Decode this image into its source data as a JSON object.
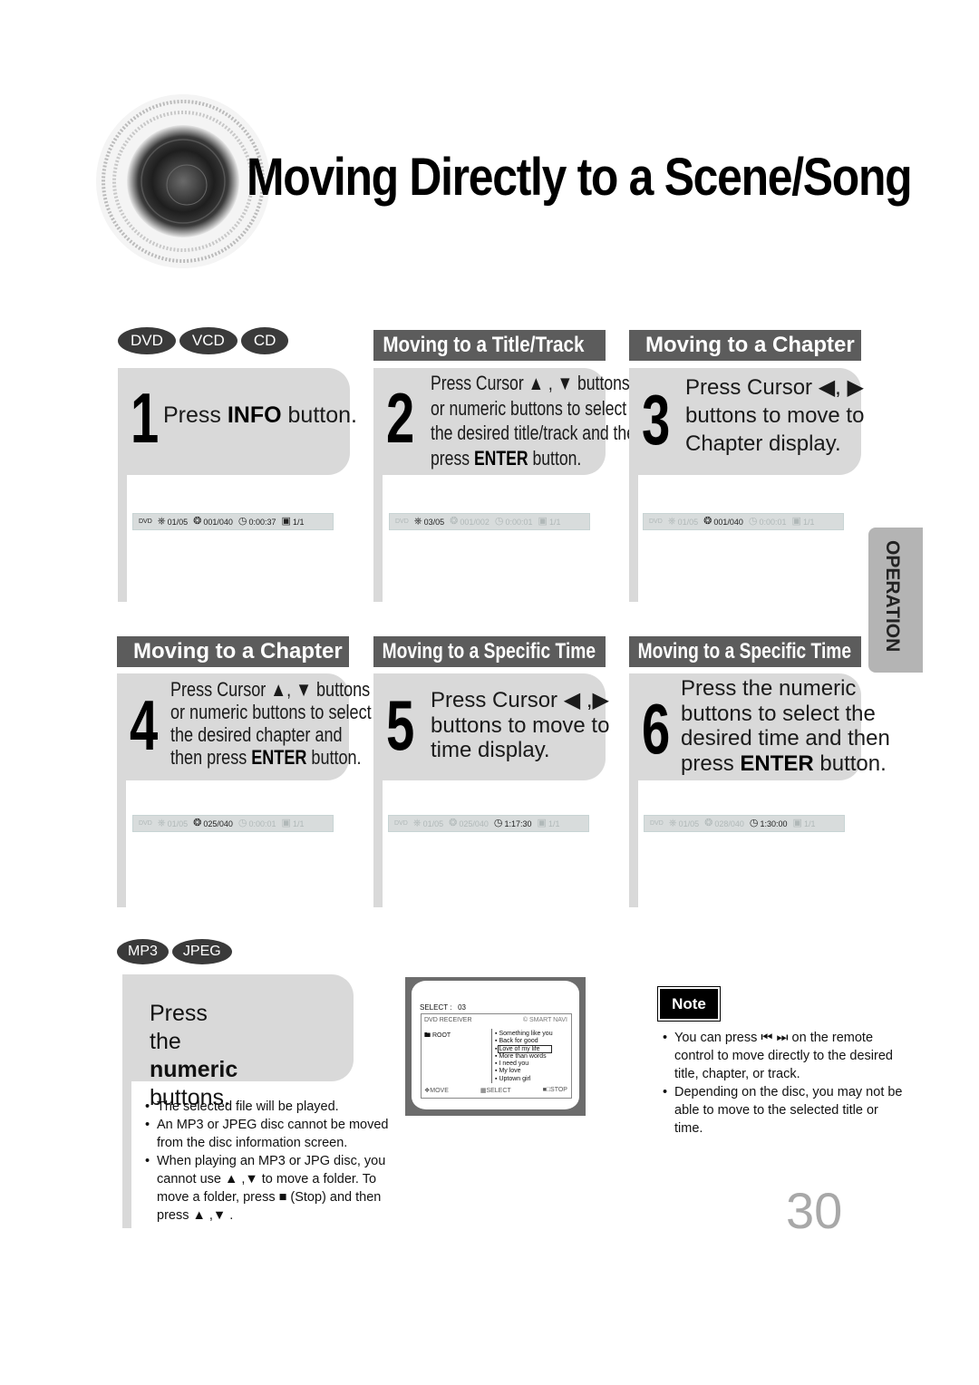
{
  "page": {
    "title": "Moving Directly to a Scene/Song",
    "page_number": "30",
    "side_tab": "OPERATION"
  },
  "disc_badges": [
    "DVD",
    "VCD",
    "CD"
  ],
  "file_badges": [
    "MP3",
    "JPEG"
  ],
  "sections": {
    "title_track": "Moving to a Title/Track",
    "chapter_top": "Moving to a Chapter",
    "chapter_bottom": "Moving to a Chapter",
    "time_5": "Moving to a Specific Time",
    "time_6": "Moving to a Specific Time"
  },
  "steps": [
    {
      "number": "1",
      "lines": [
        [
          "Press ",
          "INFO",
          " button."
        ]
      ],
      "infobar": {
        "disc": "DVD",
        "title": "01/05",
        "chapter": "001/040",
        "time": "0:00:37",
        "angle": "1/1",
        "highlight": "all"
      }
    },
    {
      "number": "2",
      "lines": [
        [
          "Press Cursor ",
          "",
          " ▲ , ▼ buttons"
        ],
        [
          "or numeric buttons to select",
          "",
          ""
        ],
        [
          "the desired title/track and then",
          "",
          ""
        ],
        [
          "press ",
          "ENTER",
          " button."
        ]
      ],
      "infobar": {
        "disc": "DVD",
        "title": "03/05",
        "chapter": "001/002",
        "time": "0:00:01",
        "angle": "1/1",
        "highlight": "title"
      }
    },
    {
      "number": "3",
      "lines": [
        [
          "Press Cursor ◀, ▶",
          "",
          ""
        ],
        [
          "buttons to move to",
          "",
          ""
        ],
        [
          "Chapter display.",
          "",
          ""
        ]
      ],
      "infobar": {
        "disc": "DVD",
        "title": "01/05",
        "chapter": "001/040",
        "time": "0:00:01",
        "angle": "1/1",
        "highlight": "chapter"
      }
    },
    {
      "number": "4",
      "lines": [
        [
          "Press Cursor ▲, ▼ buttons",
          "",
          ""
        ],
        [
          "or numeric buttons to select",
          "",
          ""
        ],
        [
          "the desired chapter and",
          "",
          ""
        ],
        [
          "then press ",
          "ENTER",
          " button."
        ]
      ],
      "infobar": {
        "disc": "DVD",
        "title": "01/05",
        "chapter": "025/040",
        "time": "0:00:01",
        "angle": "1/1",
        "highlight": "chapter"
      }
    },
    {
      "number": "5",
      "lines": [
        [
          "Press Cursor ◀ ,▶",
          "",
          ""
        ],
        [
          "buttons to move to",
          "",
          ""
        ],
        [
          "time display.",
          "",
          ""
        ]
      ],
      "infobar": {
        "disc": "DVD",
        "title": "01/05",
        "chapter": "025/040",
        "time": "1:17:30",
        "angle": "1/1",
        "highlight": "time"
      }
    },
    {
      "number": "6",
      "lines": [
        [
          "Press the numeric",
          "",
          ""
        ],
        [
          "buttons to select the",
          "",
          ""
        ],
        [
          "desired time and then",
          "",
          ""
        ],
        [
          "press ",
          "ENTER",
          " button."
        ]
      ],
      "infobar": {
        "disc": "DVD",
        "title": "01/05",
        "chapter": "028/040",
        "time": "1:30:00",
        "angle": "1/1",
        "highlight": "time"
      }
    }
  ],
  "mp3": {
    "instruction_pre": "Press the ",
    "instruction_bold": "numeric",
    "instruction_post": "buttons.",
    "bullets": [
      "The selected file will be played.",
      "An MP3 or JPEG disc cannot be moved from the disc information screen.",
      "When playing an MP3 or JPG disc, you cannot use ▲ ,▼  to move a folder. To move a folder, press ■ (Stop) and then press ▲ ,▼ ."
    ]
  },
  "screen": {
    "select_label": "SELECT :",
    "select_value": "03",
    "header_left": "DVD RECEIVER",
    "header_right": "© SMART NAVI",
    "root": "ROOT",
    "files": [
      "Something like you",
      "Back for good",
      "Love of my life",
      "More than words",
      "I need you",
      "My love",
      "Uptown girl"
    ],
    "highlighted_index": 2,
    "footer": [
      "MOVE",
      "SELECT",
      "STOP"
    ]
  },
  "note": {
    "label": "Note",
    "bullets": [
      "You can press ⏮ ⏭ on the remote control to move directly to the desired title, chapter, or track.",
      "Depending on the disc, you may not be able to move to the selected title or time."
    ]
  }
}
